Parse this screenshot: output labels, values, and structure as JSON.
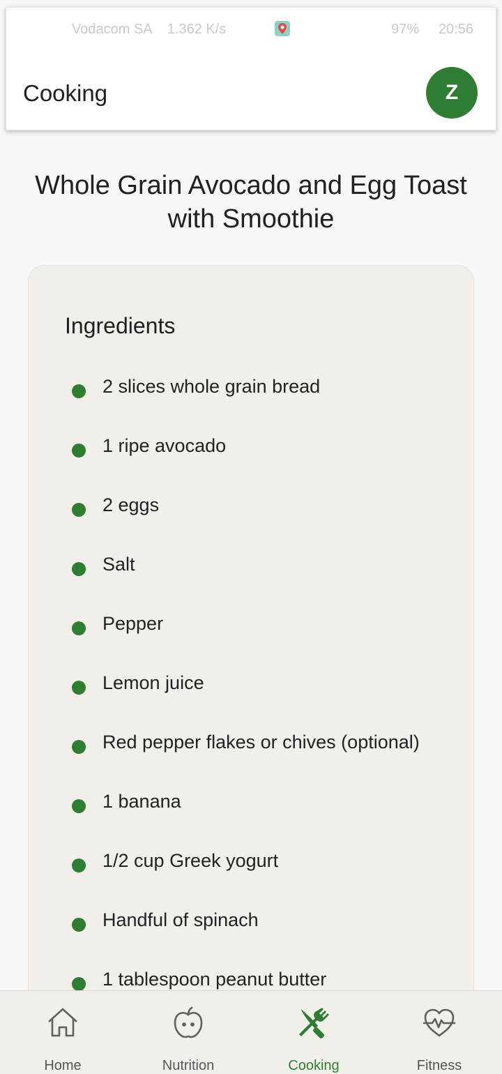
{
  "status_bar": {
    "carrier": "Vodacom SA",
    "speed": "1.362 K/s",
    "battery": "97%",
    "time": "20:56"
  },
  "header": {
    "title": "Cooking",
    "avatar_letter": "Z"
  },
  "recipe": {
    "title": "Whole Grain Avocado and Egg Toast with Smoothie"
  },
  "ingredients": {
    "heading": "Ingredients",
    "items": [
      "2 slices whole grain bread",
      "1 ripe avocado",
      "2 eggs",
      "Salt",
      "Pepper",
      "Lemon juice",
      "Red pepper flakes or chives (optional)",
      "1 banana",
      "1/2 cup Greek yogurt",
      "Handful of spinach",
      "1 tablespoon peanut butter"
    ]
  },
  "bottom_nav": {
    "items": [
      {
        "label": "Home",
        "icon": "home-icon"
      },
      {
        "label": "Nutrition",
        "icon": "apple-icon"
      },
      {
        "label": "Cooking",
        "icon": "fork-knife-icon",
        "active": true
      },
      {
        "label": "Fitness",
        "icon": "heart-pulse-icon"
      }
    ]
  },
  "colors": {
    "accent": "#2e7d32",
    "card": "#f2efeb",
    "background": "#f7f7f7"
  }
}
